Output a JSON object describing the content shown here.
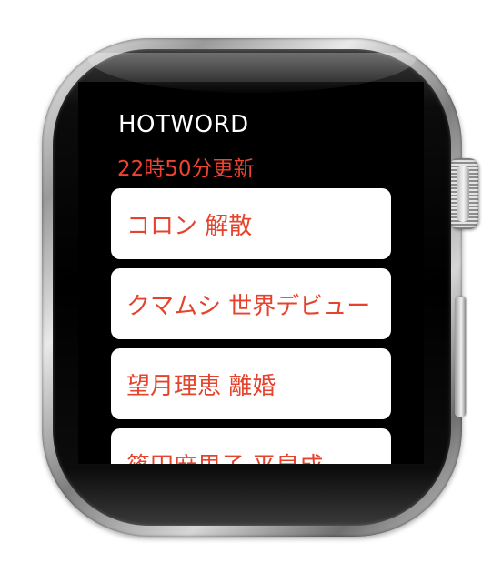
{
  "app": {
    "title": "HOTWORD",
    "updated": "22時50分更新"
  },
  "hotwords": [
    {
      "label": "コロン 解散"
    },
    {
      "label": "クマムシ 世界デビュー"
    },
    {
      "label": "望月理恵 離婚"
    },
    {
      "label": "篠田麻里子 平泉成"
    }
  ],
  "colors": {
    "accent": "#ef4231",
    "card_text": "#e5432d",
    "card_bg": "#ffffff",
    "screen_bg": "#000000"
  }
}
